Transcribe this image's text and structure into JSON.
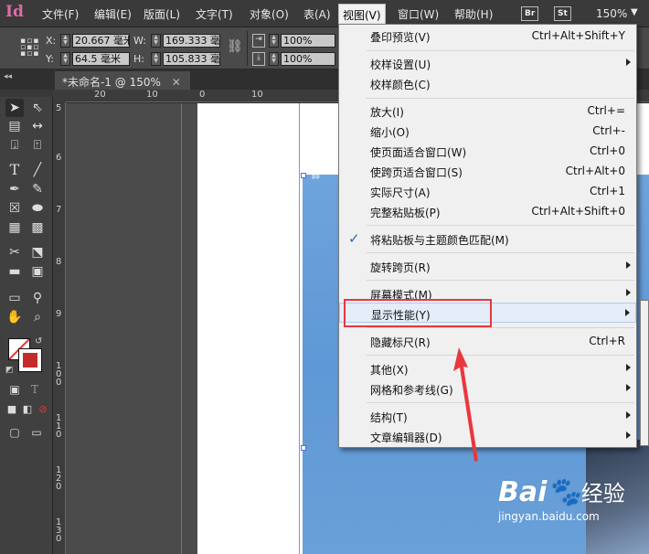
{
  "app": {
    "logo": "Id"
  },
  "menubar": {
    "items": [
      "文件(F)",
      "编辑(E)",
      "版面(L)",
      "文字(T)",
      "对象(O)",
      "表(A)",
      "视图(V)",
      "窗口(W)",
      "帮助(H)"
    ],
    "bridge_badge": "Br",
    "stock_badge": "St",
    "zoom": "150%"
  },
  "control": {
    "x_label": "X:",
    "y_label": "Y:",
    "w_label": "W:",
    "h_label": "H:",
    "x_value": "20.667 毫米",
    "y_value": "64.5 毫米",
    "w_value": "169.333 毫",
    "h_value": "105.833 毫",
    "scale_x": "100%",
    "scale_y": "100%"
  },
  "document_tab": "*未命名-1 @ 150%",
  "ruler_top": [
    "20",
    "10",
    "0",
    "10"
  ],
  "ruler_left": [
    "5",
    "6",
    "7",
    "8",
    "9",
    "1 0 0",
    "1 1 0",
    "1 2 0",
    "1 3 0"
  ],
  "view_menu": {
    "items": [
      {
        "label": "叠印预览(V)",
        "shortcut": "Ctrl+Alt+Shift+Y"
      },
      {
        "label": "校样设置(U)",
        "submenu": true
      },
      {
        "label": "校样颜色(C)"
      },
      {
        "label": "放大(I)",
        "shortcut": "Ctrl+="
      },
      {
        "label": "缩小(O)",
        "shortcut": "Ctrl+-"
      },
      {
        "label": "使页面适合窗口(W)",
        "shortcut": "Ctrl+0"
      },
      {
        "label": "使跨页适合窗口(S)",
        "shortcut": "Ctrl+Alt+0"
      },
      {
        "label": "实际尺寸(A)",
        "shortcut": "Ctrl+1"
      },
      {
        "label": "完整粘贴板(P)",
        "shortcut": "Ctrl+Alt+Shift+0"
      },
      {
        "label": "将粘贴板与主题颜色匹配(M)",
        "checked": true
      },
      {
        "label": "旋转跨页(R)",
        "submenu": true
      },
      {
        "label": "屏幕模式(M)",
        "submenu": true
      },
      {
        "label": "显示性能(Y)",
        "submenu": true,
        "highlighted": true
      },
      {
        "label": "隐藏标尺(R)",
        "shortcut": "Ctrl+R"
      },
      {
        "label": "其他(X)",
        "submenu": true
      },
      {
        "label": "网格和参考线(G)",
        "submenu": true
      },
      {
        "label": "结构(T)",
        "submenu": true
      },
      {
        "label": "文章编辑器(D)",
        "submenu": true
      }
    ]
  },
  "colors": {
    "highlight_box": "#e8383d",
    "check_mark": "#2a64c6",
    "photo_sky": "#5e98d6"
  },
  "watermark": {
    "brand": "Bai",
    "brand2": "经验",
    "url": "jingyan.baidu.com"
  }
}
